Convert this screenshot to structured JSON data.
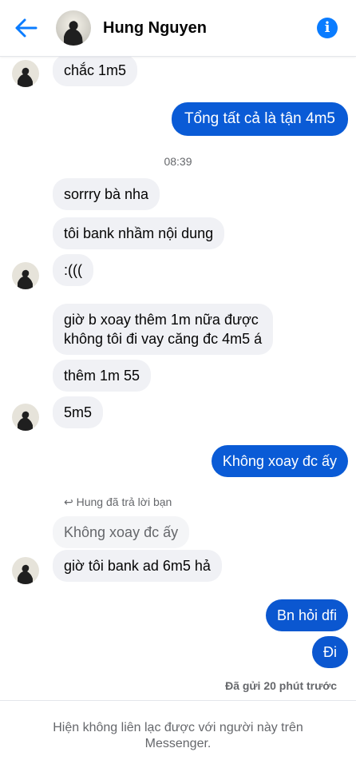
{
  "header": {
    "name": "Hung Nguyen",
    "back_icon": "arrow-left-icon",
    "info_icon": "info-icon",
    "accent": "#0a7cff"
  },
  "messages": [
    {
      "dir": "in",
      "text": "chắc 1m5"
    },
    {
      "dir": "out",
      "text": "Tổng tất cả là tận 4m5"
    },
    {
      "dir": "time",
      "text": "08:39"
    },
    {
      "dir": "in",
      "text": "sorrry bà nha"
    },
    {
      "dir": "in",
      "text": "tôi bank nhầm nội dung"
    },
    {
      "dir": "in",
      "text": ":((("
    },
    {
      "dir": "in",
      "text": "giờ b xoay thêm 1m nữa được"
    },
    {
      "dir": "in",
      "text": "không tôi đi vay căng đc 4m5 á"
    },
    {
      "dir": "in",
      "text": "thêm 1m 55"
    },
    {
      "dir": "in",
      "text": "5m5"
    },
    {
      "dir": "out",
      "text": "Không xoay đc ấy"
    },
    {
      "dir": "reply-note",
      "text": "Hung đã trả lời bạn"
    },
    {
      "dir": "quote",
      "text": "Không xoay đc ấy"
    },
    {
      "dir": "in",
      "text": "giờ tôi bank ad 6m5 hả"
    },
    {
      "dir": "out",
      "text": "Bn hỏi dfi"
    },
    {
      "dir": "out",
      "text": "Đi"
    }
  ],
  "status": "Đã gửi 20 phút trước",
  "footer": {
    "line1": "Hiện không liên lạc được với người này trên",
    "line2": "Messenger."
  }
}
